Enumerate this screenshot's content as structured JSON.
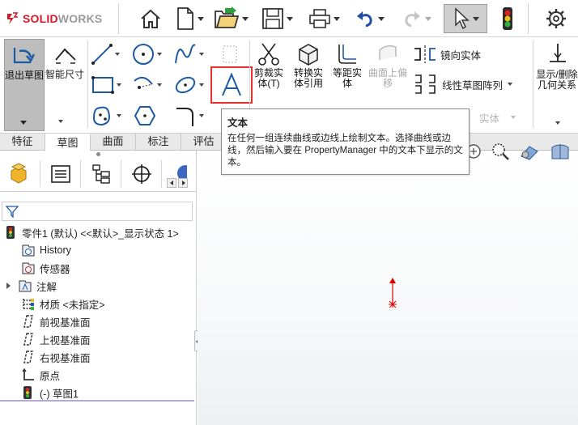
{
  "app": {
    "logo_prefix": "3S",
    "logo_solid": "SOLID",
    "logo_works": "WORKS"
  },
  "ribbon": {
    "exit_sketch": "退出草图",
    "smart_dimension": "智能尺寸",
    "trim": "剪裁实体(T)",
    "convert": "转换实体引用",
    "offset": "等距实体",
    "surface_offset": "曲面上偏移",
    "mirror": "镜向实体",
    "linear_pattern": "线性草图阵列",
    "move_faded": "实体",
    "show_relations": "显示/删除几何关系"
  },
  "tabs": [
    "特征",
    "草图",
    "曲面",
    "标注",
    "评估"
  ],
  "active_tab": "草图",
  "tooltip": {
    "title": "文本",
    "body": "在任何一组连续曲线或边线上绘制文本。选择曲线或边线，然后输入要在 PropertyManager 中的文本下显示的文本。"
  },
  "tree": {
    "root": "零件1 (默认) <<默认>_显示状态 1>",
    "items": [
      {
        "label": "History",
        "icon": "history-icon"
      },
      {
        "label": "传感器",
        "icon": "sensor-icon"
      },
      {
        "label": "注解",
        "icon": "annotation-icon"
      },
      {
        "label": "材质 <未指定>",
        "icon": "material-icon"
      },
      {
        "label": "前视基准面",
        "icon": "plane-icon"
      },
      {
        "label": "上视基准面",
        "icon": "plane-icon"
      },
      {
        "label": "右视基准面",
        "icon": "plane-icon"
      },
      {
        "label": "原点",
        "icon": "origin-icon"
      },
      {
        "label": "(-) 草图1",
        "icon": "sketch-icon"
      }
    ]
  },
  "colors": {
    "accent_red": "#e8312f",
    "logo_red": "#d11a2a",
    "origin_red": "#d40000",
    "tab_bg": "#e9e9e9",
    "exit_btn_bg": "#bdbdbd"
  }
}
